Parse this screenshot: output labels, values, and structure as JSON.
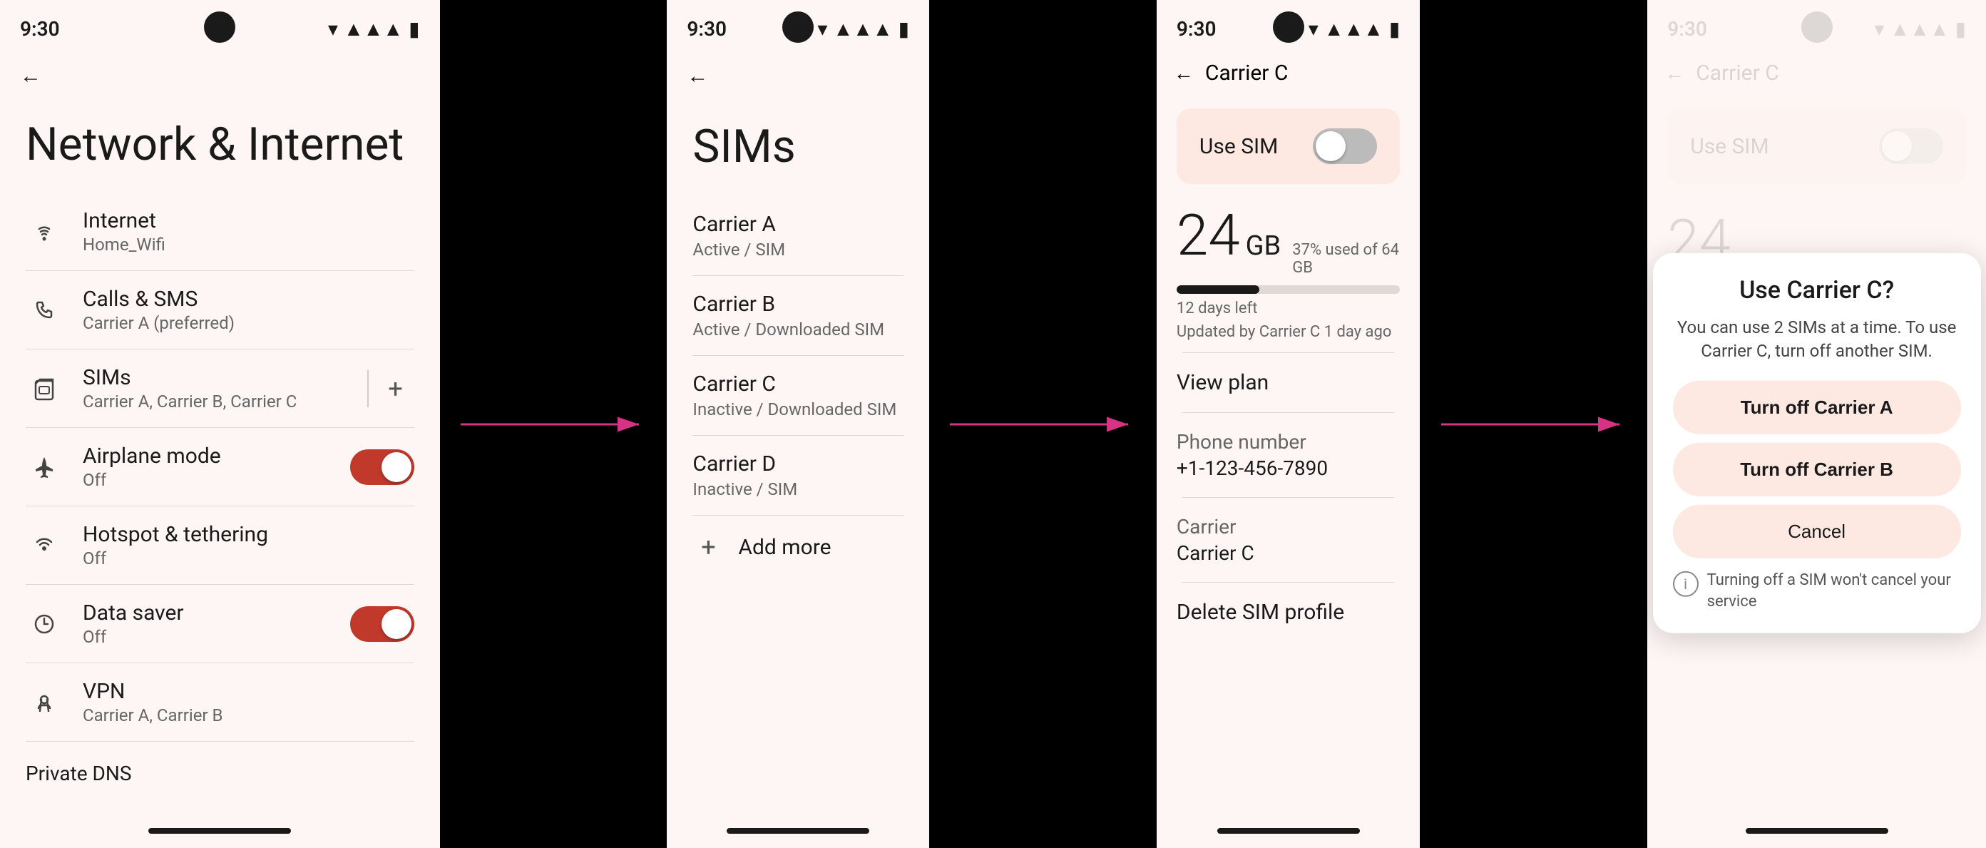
{
  "screens": {
    "screen1": {
      "time": "9:30",
      "title": "Network & Internet",
      "items": [
        {
          "id": "internet",
          "label": "Internet",
          "sub": "Home_Wifi",
          "icon": "wifi"
        },
        {
          "id": "calls-sms",
          "label": "Calls & SMS",
          "sub": "Carrier A (preferred)",
          "icon": "phone"
        },
        {
          "id": "sims",
          "label": "SIMs",
          "sub": "Carrier A, Carrier B, Carrier C",
          "icon": "sim",
          "hasAdd": true
        },
        {
          "id": "airplane",
          "label": "Airplane mode",
          "sub": "Off",
          "icon": "airplane",
          "toggle": "on"
        },
        {
          "id": "hotspot",
          "label": "Hotspot & tethering",
          "sub": "Off",
          "icon": "hotspot"
        },
        {
          "id": "datasaver",
          "label": "Data saver",
          "sub": "Off",
          "icon": "data",
          "toggle": "on"
        },
        {
          "id": "vpn",
          "label": "VPN",
          "sub": "Carrier A, Carrier B",
          "icon": "vpn"
        }
      ],
      "bottom": "Private DNS"
    },
    "screen2": {
      "time": "9:30",
      "title": "SIMs",
      "items": [
        {
          "id": "carrier-a",
          "label": "Carrier A",
          "sub": "Active / SIM"
        },
        {
          "id": "carrier-b",
          "label": "Carrier B",
          "sub": "Active / Downloaded SIM"
        },
        {
          "id": "carrier-c",
          "label": "Carrier C",
          "sub": "Inactive / Downloaded SIM"
        },
        {
          "id": "carrier-d",
          "label": "Carrier D",
          "sub": "Inactive / SIM"
        }
      ],
      "addMore": "Add more"
    },
    "screen3": {
      "time": "9:30",
      "backLabel": "←",
      "title": "Carrier C",
      "useSim": "Use SIM",
      "dataAmount": "24",
      "dataUnit": "GB",
      "dataPercent": "37% used of 64 GB",
      "daysLeft": "12 days left",
      "updatedBy": "Updated by Carrier C 1 day ago",
      "viewPlan": "View plan",
      "phoneNumberLabel": "Phone number",
      "phoneNumber": "+1-123-456-7890",
      "carrierLabel": "Carrier",
      "carrierValue": "Carrier C",
      "deleteProfile": "Delete SIM profile"
    },
    "screen4": {
      "time": "9:30",
      "backLabel": "←",
      "title": "Carrier C",
      "useSim": "Use SIM",
      "dataAmountPartial": "24",
      "dialog": {
        "title": "Use Carrier C?",
        "desc": "You can use 2 SIMs at a time. To use Carrier C, turn off another SIM.",
        "btn1": "Turn off Carrier A",
        "btn2": "Turn off Carrier B",
        "cancel": "Cancel",
        "note": "Turning off a SIM won't cancel your service"
      }
    }
  },
  "icons": {
    "wifi": "◈",
    "phone": "☎",
    "sim": "▣",
    "airplane": "✈",
    "hotspot": "⊙",
    "data": "⊘",
    "vpn": "⚿",
    "back": "←",
    "plus": "+",
    "info": "i"
  },
  "colors": {
    "accent": "#c0392b",
    "toggleOn": "#c0392b",
    "toggleOff": "#bbb",
    "bg": "#fdf6f4",
    "cardBg": "#fde8e2",
    "arrowColor": "#d63384",
    "dialogBg": "#ffffff"
  }
}
